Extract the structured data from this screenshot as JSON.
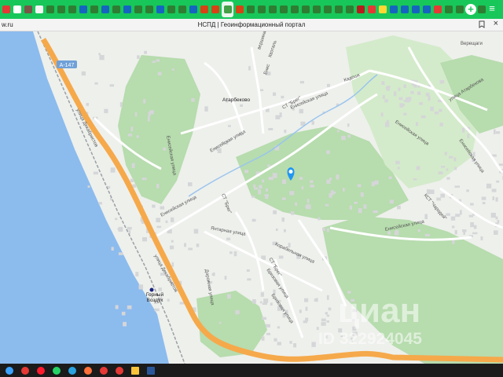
{
  "browser": {
    "tabs": [
      {
        "name": "tab-site",
        "color": "#e53935"
      },
      {
        "name": "tab-site",
        "color": "#ffffff"
      },
      {
        "name": "tab-site",
        "color": "#795548"
      },
      {
        "name": "tab-doc",
        "color": "#f5f5f5"
      },
      {
        "name": "tab-site",
        "color": "#2e7d32"
      },
      {
        "name": "tab-site",
        "color": "#2e7d32"
      },
      {
        "name": "tab-site",
        "color": "#2e7d32"
      },
      {
        "name": "tab-site",
        "color": "#1565c0"
      },
      {
        "name": "tab-site",
        "color": "#2e7d32"
      },
      {
        "name": "tab-site",
        "color": "#1565c0"
      },
      {
        "name": "tab-site",
        "color": "#2e7d32"
      },
      {
        "name": "tab-site",
        "color": "#1565c0"
      },
      {
        "name": "tab-site",
        "color": "#2e7d32"
      },
      {
        "name": "tab-site",
        "color": "#2e7d32"
      },
      {
        "name": "tab-site",
        "color": "#1565c0"
      },
      {
        "name": "tab-site",
        "color": "#2e7d32"
      },
      {
        "name": "tab-site",
        "color": "#2e7d32"
      },
      {
        "name": "tab-site",
        "color": "#1565c0"
      },
      {
        "name": "tab-site",
        "color": "#d84315"
      },
      {
        "name": "tab-site",
        "color": "#d84315"
      },
      {
        "name": "tab-active",
        "color": "#43a047",
        "active": true
      },
      {
        "name": "tab-site",
        "color": "#d84315"
      },
      {
        "name": "tab-site",
        "color": "#2e7d32"
      },
      {
        "name": "tab-site",
        "color": "#2e7d32"
      },
      {
        "name": "tab-site",
        "color": "#2e7d32"
      },
      {
        "name": "tab-site",
        "color": "#2e7d32"
      },
      {
        "name": "tab-site",
        "color": "#2e7d32"
      },
      {
        "name": "tab-site",
        "color": "#2e7d32"
      },
      {
        "name": "tab-site",
        "color": "#2e7d32"
      },
      {
        "name": "tab-site",
        "color": "#2e7d32"
      },
      {
        "name": "tab-site",
        "color": "#2e7d32"
      },
      {
        "name": "tab-site",
        "color": "#2e7d32"
      },
      {
        "name": "tab-site",
        "color": "#b71c1c"
      },
      {
        "name": "tab-site",
        "color": "#e53935"
      },
      {
        "name": "tab-site",
        "color": "#fdd835"
      },
      {
        "name": "tab-site",
        "color": "#1565c0"
      },
      {
        "name": "tab-site",
        "color": "#1565c0"
      },
      {
        "name": "tab-site",
        "color": "#1565c0"
      },
      {
        "name": "tab-site",
        "color": "#1565c0"
      },
      {
        "name": "tab-site",
        "color": "#e53935"
      },
      {
        "name": "tab-site",
        "color": "#2e7d32"
      },
      {
        "name": "tab-site",
        "color": "#2e7d32"
      },
      {
        "name": "tab-site",
        "color": "#d84315"
      },
      {
        "name": "tab-site",
        "color": "#2e7d32"
      }
    ],
    "new_tab_glyph": "+",
    "menu_glyph": "≡",
    "url_fragment": "w.ru",
    "page_title": "НСПД | Геоинформационный портал",
    "close_glyph": "×"
  },
  "map": {
    "colors": {
      "land": "#eef0ec",
      "sea": "#8cbbee",
      "forest": "#b7dcae",
      "forest_light": "#d4ebcb",
      "highway": "#f6a94a",
      "road": "#ffffff",
      "rail": "#9aa0a6",
      "building": "#d5d6d8",
      "river": "#9ac4ee",
      "marker": "#2196f3"
    },
    "highway_badge": "A-147",
    "labels": {
      "dekabristov_1": "улица Декабристов",
      "dekabristov_2": "улица Декабристов",
      "eniseyskaya_1": "Енисейская улица",
      "eniseyskaya_2": "Енисейская улица",
      "eniseyskaya_3": "Енисейская улица",
      "eniseyskaya_4": "Енисейская улица",
      "eniseyskaya_5": "Енисейская улица",
      "eniseyskaya_6": "Енисейская улица",
      "eniseyskaya_7": "Енисейская улица",
      "atarbekovo": "Атарбеково",
      "atarbekova_st": "улица Атарбекова",
      "st_breg_1": "СТ \"Брег\"",
      "st_breg_2": "СТ \"Брег\"",
      "st_breg_3": "СТ \"Брег\"",
      "yantarnaya": "Янтарная улица",
      "korabelnaya": "Корабельная улица",
      "dorozhnaya": "Дорожная улица",
      "bryzovaya_1": "Бризовая улица",
      "bryzovaya_2": "Бризовая улица",
      "kst_charodey": "КСТ \"Чародей\"",
      "vereshchagin": "Верещаги",
      "vershina": "вершина",
      "kvetalia": "Квэталь",
      "gorny_vozdukh": "Горный Воздух",
      "enis_1": "Енис",
      "kadoshk": "Кадошк"
    },
    "watermark": {
      "brand": "циан",
      "id": "ID 322924045"
    }
  },
  "taskbar": {
    "items": [
      {
        "name": "windows-start-icon",
        "color": "#3aa2ff"
      },
      {
        "name": "chrome-icon",
        "color": "#e53935"
      },
      {
        "name": "opera-icon",
        "color": "#ff1b2d"
      },
      {
        "name": "whatsapp-icon",
        "color": "#25d366"
      },
      {
        "name": "telegram-icon",
        "color": "#2aa3e0"
      },
      {
        "name": "firefox-icon",
        "color": "#ff7139"
      },
      {
        "name": "yandex-browser-icon",
        "color": "#e53935"
      },
      {
        "name": "yandex-browser-icon",
        "color": "#e53935"
      },
      {
        "name": "file-explorer-icon",
        "color": "#f8c33a",
        "square": true
      },
      {
        "name": "word-icon",
        "color": "#2b579a",
        "square": true
      }
    ]
  }
}
